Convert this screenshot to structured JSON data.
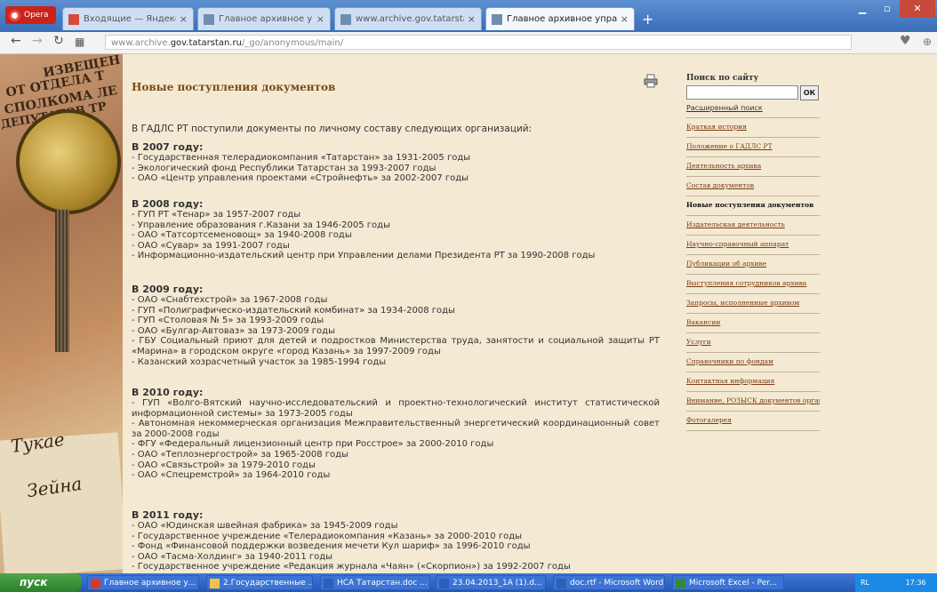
{
  "browser": {
    "menu_label": "Opera",
    "tabs": [
      {
        "label": "Входящие — Яндекс.Почта",
        "close": "×"
      },
      {
        "label": "Главное архивное управл",
        "close": "×"
      },
      {
        "label": "www.archive.gov.tatarstan",
        "close": "×"
      },
      {
        "label": "Главное архивное управле",
        "close": "×"
      }
    ],
    "new_tab": "+",
    "url_prefix": "www.archive.",
    "url_domain": "gov.tatarstan.ru",
    "url_path": "/_go/anonymous/main/"
  },
  "page": {
    "title": "Новые поступления документов",
    "intro": "В ГАДЛС РТ поступили документы по личному составу следующих организаций:",
    "years": [
      {
        "heading": "В 2007 году:",
        "items": [
          "- Государственная телерадиокомпания «Татарстан» за 1931-2005 годы",
          "- Экологический фонд Республики Татарстан за 1993-2007 годы",
          "- ОАО «Центр управления проектами «Стройнефть» за 2002-2007 годы"
        ]
      },
      {
        "heading": "В 2008 году:",
        "items": [
          "- ГУП РТ «Тенар» за 1957-2007 годы",
          "- Управление образования г.Казани за 1946-2005 годы",
          "- ОАО «Татсортсеменовощ» за 1940-2008 годы",
          "- ОАО «Сувар» за 1991-2007 годы",
          "- Информационно-издательский центр при Управлении делами Президента РТ за 1990-2008 годы"
        ]
      },
      {
        "heading": "В 2009 году:",
        "items": [
          "- ОАО «Снабтехстрой» за 1967-2008 годы",
          "- ГУП «Полиграфическо-издательский комбинат» за 1934-2008 годы",
          "- ГУП «Столовая № 5» за 1993-2009 годы",
          "- ОАО «Булгар-Автоваз» за 1973-2009 годы",
          "- ГБУ Социальный приют для детей и подростков Министерства труда, занятости и социальной защиты РТ «Марина» в городском округе «город Казань» за 1997-2009 годы",
          "- Казанский хозрасчетный участок за 1985-1994 годы"
        ]
      },
      {
        "heading": "В 2010 году:",
        "items": [
          "- ГУП «Волго-Вятский научно-исследовательский и проектно-технологический институт статистической информационной системы» за 1973-2005 годы",
          "- Автономная некоммерческая организация Межправительственный энергетический координационный совет за 2000-2008 годы",
          "- ФГУ «Федеральный лицензионный центр при Росстрое» за 2000-2010 годы",
          "- ОАО «Теплоэнергострой» за 1965-2008 годы",
          "- ОАО «Связьстрой» за 1979-2010 годы",
          "- ОАО «Спецремстрой» за 1964-2010 годы"
        ]
      },
      {
        "heading": "В 2011 году:",
        "items": [
          "- ОАО «Юдинская швейная фабрика» за 1945-2009 годы",
          "- Государственное учреждение «Телерадиокомпания «Казань» за 2000-2010 годы",
          "- Фонд «Финансовой поддержки возведения мечети Кул шариф» за 1996-2010 годы",
          "- ОАО «Тасма-Холдинг» за 1940-2011 годы",
          "- Государственное учреждение «Редакция журнала «Чаян» («Скорпион») за 1992-2007 годы"
        ]
      }
    ]
  },
  "sidebar": {
    "search_label": "Поиск по сайту",
    "search_button": "ОК",
    "advanced_search": "Расширенный поиск",
    "menu": [
      "Краткая история",
      "Положение о ГАДЛС РТ",
      "Деятельность архива",
      "Состав документов",
      "Новые поступления документов",
      "Издательская деятельность",
      "Научно-справочный аппарат",
      "Публикации об архиве",
      "Выступления сотрудников архива",
      "Запросы, исполненные архивом",
      "Вакансии",
      "Услуги",
      "Справочники по фондам",
      "Контактная информация",
      "Внимание, РОЗЫСК документов организаций",
      "Фотогалерея"
    ],
    "current_index": 4
  },
  "taskbar": {
    "start": "пуск",
    "tasks": [
      "Главное архивное у...",
      "2.Государственные ...",
      "НСА Татарстан.doc ...",
      "23.04.2013_1А (1).d...",
      "doc.rtf - Microsoft Word",
      "Microsoft Excel - Per..."
    ],
    "tray_lang": "RL",
    "clock": "17:36"
  },
  "colors": {
    "title_brown": "#7b4a16",
    "link_brown": "#7b3b12",
    "page_bg": "#f4ead3"
  }
}
